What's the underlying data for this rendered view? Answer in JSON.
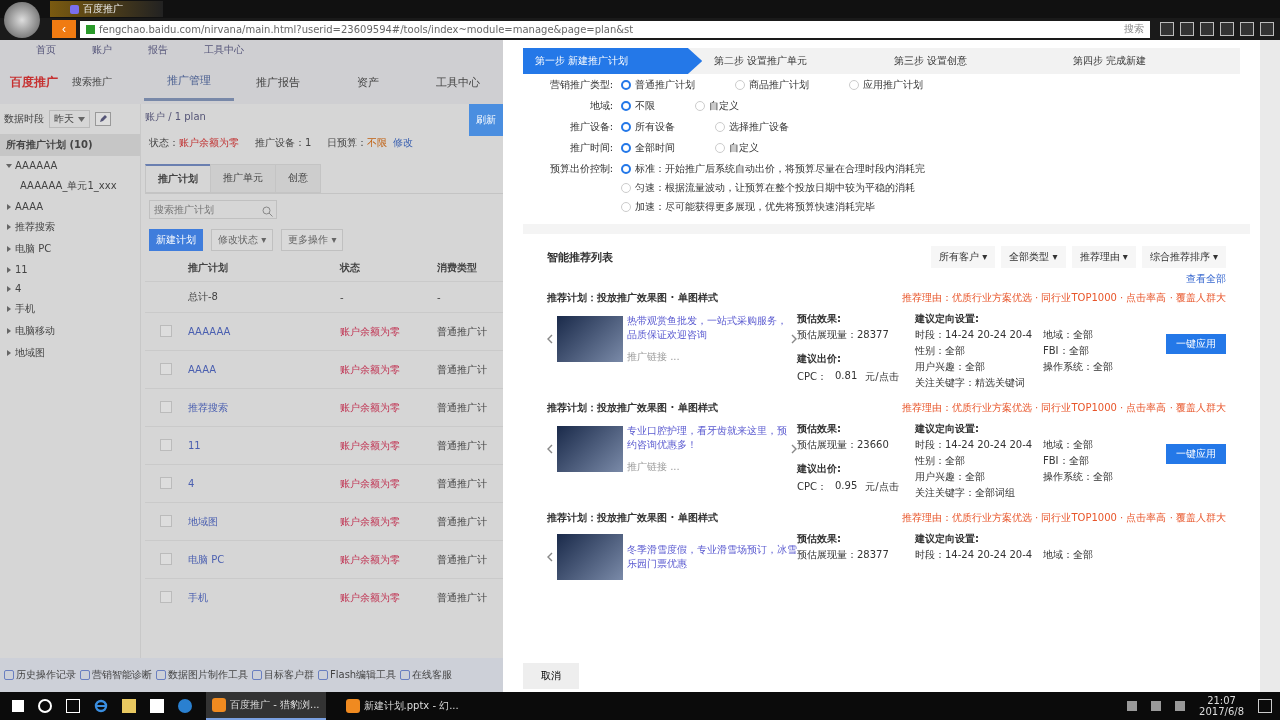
{
  "browser": {
    "tab_title": "百度推广",
    "back": "‹",
    "url": "fengchao.baidu.com/nirvana/main.html?userid=23609594#/tools/index~module=manage&page=plan&st",
    "search_hint": "搜索"
  },
  "app": {
    "top_links": [
      "首页",
      "账户",
      "报告",
      "工具中心"
    ],
    "brand": "百度推广",
    "brand_sub": "搜索推广",
    "nav": [
      {
        "label": "推广管理",
        "selected": true
      },
      {
        "label": "推广报告",
        "selected": false
      },
      {
        "label": "资产",
        "selected": false
      },
      {
        "label": "工具中心",
        "selected": false
      }
    ],
    "period_label": "数据时段",
    "period": "昨天",
    "breadcrumb": "账户 / 1 plan",
    "side_button": "刷新",
    "summary": [
      {
        "label": "状态：",
        "value": "账户余额为零",
        "kind": "alert"
      },
      {
        "label": "推广设备：",
        "value": "1",
        "kind": "plain"
      },
      {
        "label": "日预算：",
        "value": "不限",
        "kind": "warn",
        "link": "修改"
      }
    ],
    "tree": [
      {
        "label": "所有推广计划 (10)",
        "selected": true
      },
      {
        "label": "AAAAAA",
        "selected": false,
        "expanded": true,
        "children": [
          {
            "label": "AAAAAA_单元1_xxx",
            "selected": false
          }
        ]
      },
      {
        "label": "AAAA",
        "selected": false,
        "expanded": false
      },
      {
        "label": "推荐搜索",
        "selected": false,
        "expanded": false
      },
      {
        "label": "电脑 PC",
        "selected": false,
        "expanded": false
      },
      {
        "label": "11",
        "selected": false,
        "expanded": false
      },
      {
        "label": "4",
        "selected": false,
        "expanded": false
      },
      {
        "label": "手机",
        "selected": false,
        "expanded": false
      },
      {
        "label": "电脑移动",
        "selected": false,
        "expanded": false
      },
      {
        "label": "地域图",
        "selected": false,
        "expanded": false
      }
    ],
    "tabs": [
      {
        "label": "推广计划",
        "selected": true
      },
      {
        "label": "推广单元",
        "selected": false
      },
      {
        "label": "创意",
        "selected": false
      }
    ],
    "search_placeholder": "搜索推广计划",
    "actions": [
      {
        "label": "新建计划",
        "kind": "primary"
      },
      {
        "label": "修改状态 ▾",
        "kind": "plain"
      },
      {
        "label": "更多操作 ▾",
        "kind": "plain"
      }
    ],
    "columns": [
      "推广计划",
      "状态",
      "消费类型"
    ],
    "rows": [
      {
        "kind": "total",
        "name": "总计-8",
        "status": "-",
        "type": "-"
      },
      {
        "kind": "plan",
        "checked": false,
        "name": "AAAAAA",
        "status": "账户余额为零",
        "type": "普通推广计"
      },
      {
        "kind": "plan",
        "checked": false,
        "name": "AAAA",
        "status": "账户余额为零",
        "type": "普通推广计"
      },
      {
        "kind": "plan",
        "checked": false,
        "name": "推荐搜索",
        "status": "账户余额为零",
        "type": "普通推广计"
      },
      {
        "kind": "plan",
        "checked": false,
        "name": "11",
        "status": "账户余额为零",
        "type": "普通推广计"
      },
      {
        "kind": "plan",
        "checked": false,
        "name": "4",
        "status": "账户余额为零",
        "type": "普通推广计"
      },
      {
        "kind": "plan",
        "checked": false,
        "name": "地域图",
        "status": "账户余额为零",
        "type": "普通推广计"
      },
      {
        "kind": "plan",
        "checked": false,
        "name": "电脑 PC",
        "status": "账户余额为零",
        "type": "普通推广计"
      },
      {
        "kind": "plan",
        "checked": false,
        "name": "手机",
        "status": "账户余额为零",
        "type": "普通推广计"
      }
    ],
    "tools": [
      "历史操作记录",
      "营销智能诊断",
      "数据图片制作工具",
      "目标客户群",
      "Flash编辑工具",
      "在线客服"
    ]
  },
  "drawer": {
    "steps": [
      {
        "label": "第一步 新建推广计划",
        "selected": true
      },
      {
        "label": "第二步 设置推广单元",
        "selected": false
      },
      {
        "label": "第三步 设置创意",
        "selected": false
      },
      {
        "label": "第四步 完成新建",
        "selected": false
      }
    ],
    "form": [
      {
        "label": "营销推广类型:",
        "kind": "inline",
        "options": [
          {
            "text": "普通推广计划",
            "selected": true
          },
          {
            "text": "商品推广计划",
            "selected": false
          },
          {
            "text": "应用推广计划",
            "selected": false
          }
        ]
      },
      {
        "label": "地域:",
        "kind": "inline",
        "options": [
          {
            "text": "不限",
            "selected": true
          },
          {
            "text": "自定义",
            "selected": false
          }
        ]
      },
      {
        "label": "推广设备:",
        "kind": "inline",
        "options": [
          {
            "text": "所有设备",
            "selected": true
          },
          {
            "text": "选择推广设备",
            "selected": false
          }
        ]
      },
      {
        "label": "推广时间:",
        "kind": "inline",
        "options": [
          {
            "text": "全部时间",
            "selected": true
          },
          {
            "text": "自定义",
            "selected": false
          }
        ]
      },
      {
        "label": "预算出价控制:",
        "kind": "stacked",
        "options": [
          {
            "text": "标准：开始推广后系统自动出价，将预算尽量在合理时段内消耗完",
            "selected": true
          },
          {
            "text": "匀速：根据流量波动，让预算在整个投放日期中较为平稳的消耗",
            "selected": false
          },
          {
            "text": "加速：尽可能获得更多展现，优先将预算快速消耗完毕",
            "selected": false
          }
        ]
      }
    ],
    "list_title": "智能推荐列表",
    "filters": [
      "所有客户 ▾",
      "全部类型 ▾",
      "推荐理由 ▾",
      "综合推荐排序 ▾"
    ],
    "view_all": "查看全部",
    "cards": [
      {
        "title": "推荐计划：投放推广效果图 · 单图样式",
        "ad_text": "热带观赏鱼批发，一站式采购服务，品质保证欢迎咨询",
        "ad_sub": "推广链接 ...",
        "effect_label": "预估效果:",
        "impressions": "预估展现量：28377",
        "bid_label": "建议出价:",
        "cpc_label": "CPC：",
        "cpc": "0.81",
        "cpc_unit": "元/点击",
        "targeting_label": "建议定向设置:",
        "targeting": [
          "时段：14-24 20-24 20-4",
          "地域：全部",
          "性别：全部",
          "FBI：全部",
          "用户兴趣：全部",
          "操作系统：全部",
          "关注关键字：精选关键词"
        ],
        "reason": "推荐理由：优质行业方案优选 · 同行业TOP1000 · 点击率高 · 覆盖人群大",
        "button": "一键应用"
      },
      {
        "title": "推荐计划：投放推广效果图 · 单图样式",
        "ad_text": "专业口腔护理，看牙齿就来这里，预约咨询优惠多！",
        "ad_sub": "推广链接 ...",
        "effect_label": "预估效果:",
        "impressions": "预估展现量：23660",
        "bid_label": "建议出价:",
        "cpc_label": "CPC：",
        "cpc": "0.95",
        "cpc_unit": "元/点击",
        "targeting_label": "建议定向设置:",
        "targeting": [
          "时段：14-24 20-24 20-4",
          "地域：全部",
          "性别：全部",
          "FBI：全部",
          "用户兴趣：全部",
          "操作系统：全部",
          "关注关键字：全部词组"
        ],
        "reason": "推荐理由：优质行业方案优选 · 同行业TOP1000 · 点击率高 · 覆盖人群大",
        "button": "一键应用"
      },
      {
        "title": "推荐计划：投放推广效果图 · 单图样式",
        "ad_text": "冬季滑雪度假，专业滑雪场预订，冰雪乐园门票优惠",
        "effect_label": "预估效果:",
        "impressions": "预估展现量：28377",
        "targeting_label": "建议定向设置:",
        "targeting": [
          "时段：14-24 20-24 20-4",
          "地域：全部"
        ],
        "reason": "推荐理由：优质行业方案优选 · 同行业TOP1000 · 点击率高 · 覆盖人群大"
      }
    ],
    "cancel": "取消"
  },
  "taskbar": {
    "tasks": [
      {
        "label": "百度推广 - 猎豹浏...",
        "selected": true
      },
      {
        "label": "新建计划.pptx - 幻...",
        "selected": false
      }
    ],
    "time": "21:07",
    "date": "2017/6/8"
  }
}
